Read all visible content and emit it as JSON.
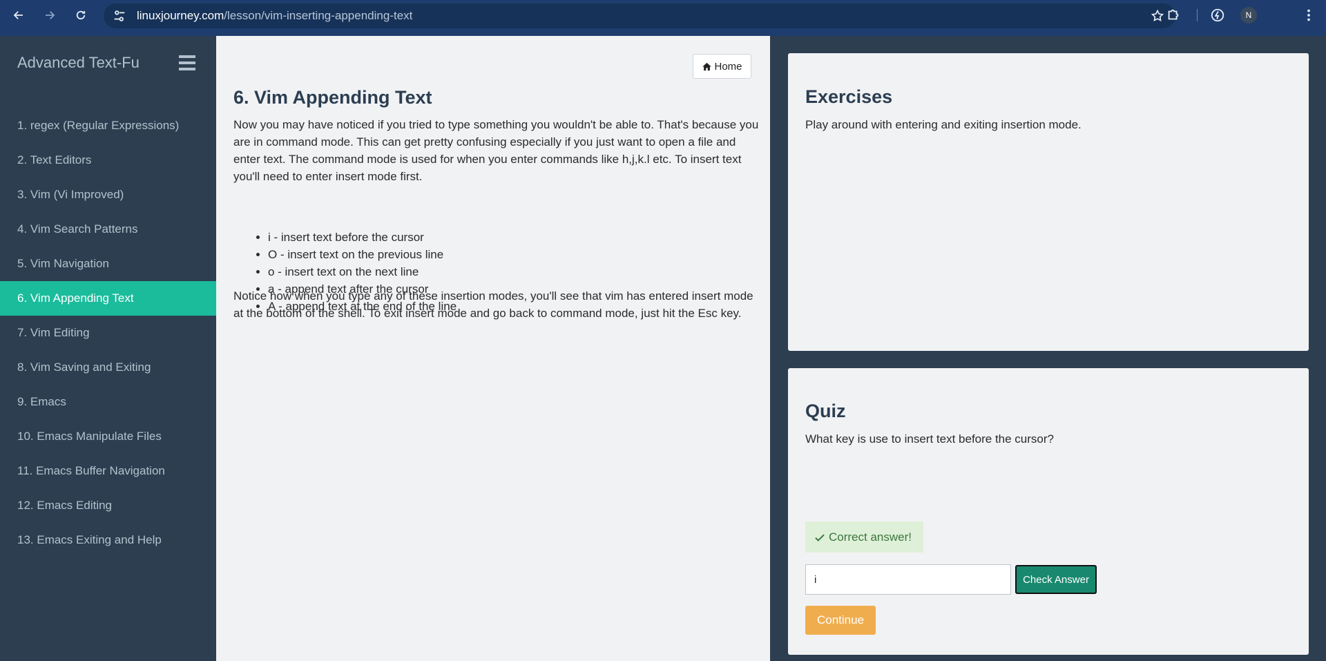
{
  "browser": {
    "url_domain": "linuxjourney.com",
    "url_path": "/lesson/vim-inserting-appending-text",
    "profile_initial": "N"
  },
  "sidebar": {
    "title": "Advanced Text-Fu",
    "items": [
      {
        "label": "1. regex (Regular Expressions)",
        "active": false
      },
      {
        "label": "2. Text Editors",
        "active": false
      },
      {
        "label": "3. Vim (Vi Improved)",
        "active": false
      },
      {
        "label": "4. Vim Search Patterns",
        "active": false
      },
      {
        "label": "5. Vim Navigation",
        "active": false
      },
      {
        "label": "6. Vim Appending Text",
        "active": true
      },
      {
        "label": "7. Vim Editing",
        "active": false
      },
      {
        "label": "8. Vim Saving and Exiting",
        "active": false
      },
      {
        "label": "9. Emacs",
        "active": false
      },
      {
        "label": "10. Emacs Manipulate Files",
        "active": false
      },
      {
        "label": "11. Emacs Buffer Navigation",
        "active": false
      },
      {
        "label": "12. Emacs Editing",
        "active": false
      },
      {
        "label": "13. Emacs Exiting and Help",
        "active": false
      }
    ]
  },
  "main": {
    "home_label": "Home",
    "title": "6. Vim Appending Text",
    "intro": "Now you may have noticed if you tried to type something you wouldn't be able to. That's because you are in command mode. This can get pretty confusing especially if you just want to open a file and enter text. The command mode is used for when you enter commands like h,j,k.l etc. To insert text you'll need to enter insert mode first.",
    "commands": [
      "i - insert text before the cursor",
      "O - insert text on the previous line",
      "o - insert text on the next line",
      "a - append text after the cursor",
      "A - append text at the end of the line"
    ],
    "outro": "Notice how when you type any of these insertion modes, you'll see that vim has entered insert mode at the bottom of the shell. To exit insert mode and go back to command mode, just hit the Esc key."
  },
  "exercises": {
    "title": "Exercises",
    "text": "Play around with entering and exiting insertion mode."
  },
  "quiz": {
    "title": "Quiz",
    "question": "What key is use to insert text before the cursor?",
    "feedback": "Correct answer!",
    "answer_value": "i",
    "check_label": "Check Answer",
    "continue_label": "Continue"
  },
  "colors": {
    "sidebar_bg": "#2c3e50",
    "active_item": "#1abc9c",
    "check_button": "#18896f",
    "continue_button": "#f0ad4e",
    "success_bg": "#dff0d8"
  }
}
